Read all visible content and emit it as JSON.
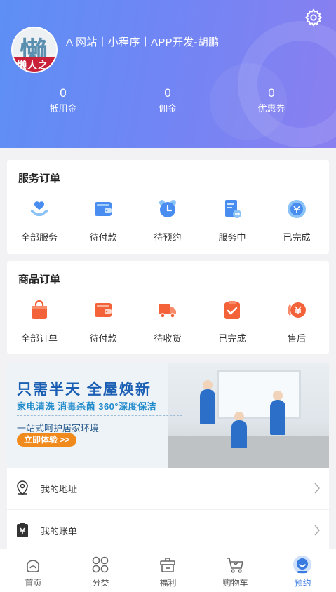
{
  "profile": {
    "username": "A 网站丨小程序丨APP开发-胡鹏",
    "avatar_text": {
      "char": "懒",
      "band": "懒人之"
    },
    "stats": [
      {
        "value": "0",
        "label": "抵用金"
      },
      {
        "value": "0",
        "label": "佣金"
      },
      {
        "value": "0",
        "label": "优惠券"
      }
    ]
  },
  "service_orders": {
    "title": "服务订单",
    "items": [
      {
        "label": "全部服务",
        "icon": "hand-heart-icon"
      },
      {
        "label": "待付款",
        "icon": "wallet-icon"
      },
      {
        "label": "待预约",
        "icon": "alarm-clock-icon"
      },
      {
        "label": "服务中",
        "icon": "document-arrow-icon"
      },
      {
        "label": "已完成",
        "icon": "coin-refresh-icon"
      }
    ]
  },
  "product_orders": {
    "title": "商品订单",
    "items": [
      {
        "label": "全部订单",
        "icon": "shopping-bag-icon"
      },
      {
        "label": "待付款",
        "icon": "wallet-icon"
      },
      {
        "label": "待收货",
        "icon": "delivery-truck-icon"
      },
      {
        "label": "已完成",
        "icon": "clipboard-check-icon"
      },
      {
        "label": "售后",
        "icon": "yen-refund-icon"
      }
    ]
  },
  "banner": {
    "headline": "只需半天 全屋焕新",
    "subline": "家电清洗 消毒杀菌 360°深度保洁",
    "tagline": "一站式呵护居家环境",
    "cta": "立即体验 >>"
  },
  "menu": [
    {
      "label": "我的地址",
      "icon": "location-pin-icon"
    },
    {
      "label": "我的账单",
      "icon": "bill-yen-icon"
    }
  ],
  "tabbar": [
    {
      "label": "首页",
      "icon": "home-icon",
      "active": false
    },
    {
      "label": "分类",
      "icon": "category-grid-icon",
      "active": false
    },
    {
      "label": "福利",
      "icon": "gift-box-icon",
      "active": false
    },
    {
      "label": "购物车",
      "icon": "cart-icon",
      "active": false
    },
    {
      "label": "预约",
      "icon": "profile-face-icon",
      "active": true
    }
  ],
  "colors": {
    "hero_gradient_start": "#5d8ff4",
    "hero_gradient_end": "#8a7ff0",
    "service_icon_blue": "#4a8df0",
    "product_icon_orange": "#f4623a",
    "tab_active": "#3a7be0"
  }
}
